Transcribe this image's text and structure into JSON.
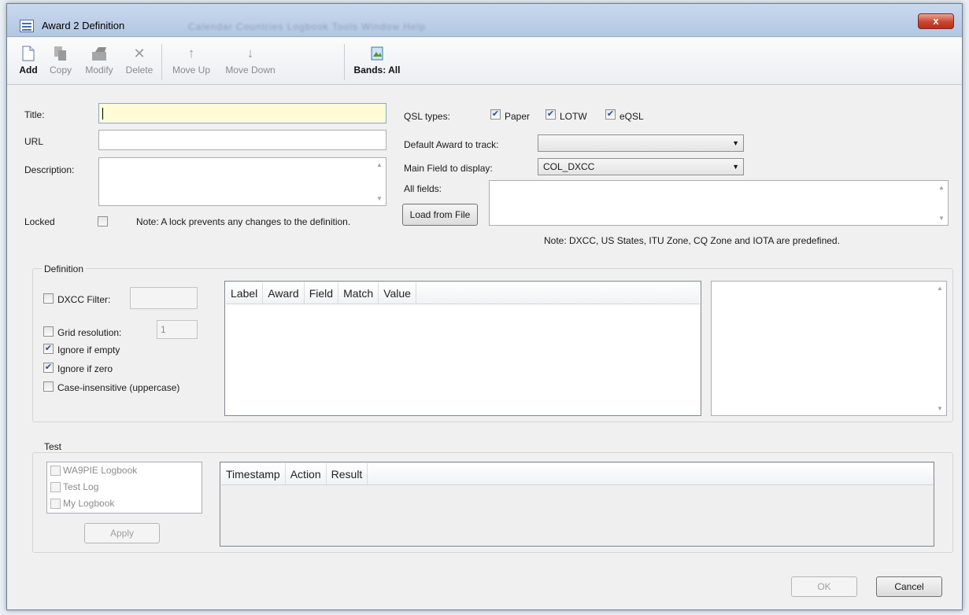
{
  "window": {
    "title": "Award 2 Definition",
    "behind_menu": "Calendar   Countries   Logbook   Tools   Window   Help",
    "close_glyph": "x"
  },
  "toolbar": {
    "add": "Add",
    "copy": "Copy",
    "modify": "Modify",
    "delete": "Delete",
    "move_up": "Move Up",
    "move_down": "Move Down",
    "bands": "Bands: All"
  },
  "form": {
    "title_label": "Title:",
    "title_value": "",
    "url_label": "URL",
    "url_value": "",
    "description_label": "Description:",
    "description_value": "",
    "locked_label": "Locked",
    "locked_note": "Note: A lock prevents any changes to the definition.",
    "qsl_types_label": "QSL types:",
    "qsl_paper": "Paper",
    "qsl_lotw": "LOTW",
    "qsl_eqsl": "eQSL",
    "default_award_label": "Default Award to track:",
    "default_award_value": "",
    "main_field_label": "Main Field to display:",
    "main_field_value": "COL_DXCC",
    "all_fields_label": "All fields:",
    "load_from_file": "Load from File",
    "predefined_note": "Note: DXCC, US States, ITU Zone, CQ Zone and IOTA are predefined."
  },
  "definition": {
    "group_title": "Definition",
    "dxcc_filter_label": "DXCC Filter:",
    "dxcc_filter_value": "",
    "grid_resolution_label": "Grid resolution:",
    "grid_resolution_value": "1",
    "ignore_if_empty": "Ignore if empty",
    "ignore_if_zero": "Ignore if zero",
    "case_insensitive": "Case-insensitive (uppercase)",
    "columns": [
      "Label",
      "Award",
      "Field",
      "Match",
      "Value"
    ]
  },
  "test": {
    "group_title": "Test",
    "logbooks": [
      "WA9PIE Logbook",
      "Test Log",
      "My Logbook"
    ],
    "apply": "Apply",
    "columns": [
      "Timestamp",
      "Action",
      "Result"
    ]
  },
  "footer": {
    "ok": "OK",
    "cancel": "Cancel"
  },
  "icons": {
    "scroll_up": "▲",
    "scroll_down": "▼",
    "combo_arrow": "▼",
    "check": "✔"
  }
}
